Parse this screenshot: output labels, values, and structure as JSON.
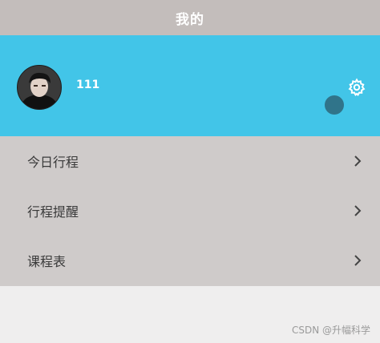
{
  "header": {
    "title": "我的"
  },
  "profile": {
    "username": "111",
    "avatar_icon": "user-avatar",
    "settings_icon": "gear-icon",
    "background_color": "#42c5e8"
  },
  "menu": {
    "items": [
      {
        "label": "今日行程",
        "icon": "chevron-right-icon"
      },
      {
        "label": "行程提醒",
        "icon": "chevron-right-icon"
      },
      {
        "label": "课程表",
        "icon": "chevron-right-icon"
      }
    ]
  },
  "watermark": {
    "text": "CSDN @升幅科学"
  }
}
